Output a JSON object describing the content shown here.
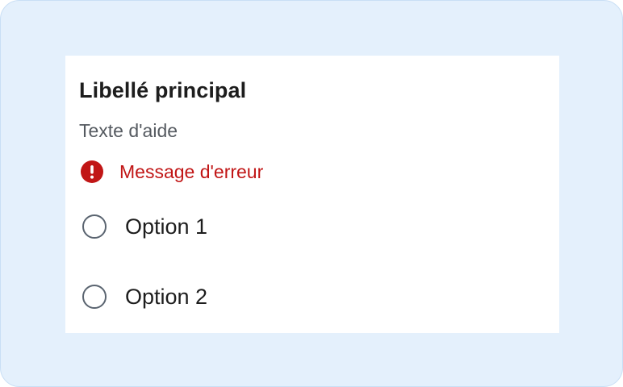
{
  "form": {
    "main_label": "Libellé principal",
    "help_text": "Texte d'aide",
    "error": {
      "icon": "exclamation-circle-icon",
      "message": "Message d'erreur",
      "color": "#c11616"
    },
    "options": [
      {
        "label": "Option 1",
        "selected": false
      },
      {
        "label": "Option 2",
        "selected": false
      }
    ]
  },
  "colors": {
    "background": "#e4f0fc",
    "panel": "#ffffff",
    "text": "#1d1d1d",
    "muted_text": "#555a60",
    "error": "#c11616",
    "radio_border": "#5a6470"
  }
}
